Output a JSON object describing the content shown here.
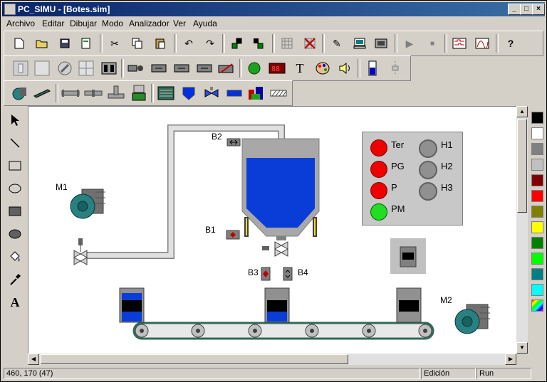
{
  "window": {
    "title": "PC_SIMU - [Botes.sim]"
  },
  "menu": [
    "Archivo",
    "Editar",
    "Dibujar",
    "Modo",
    "Analizador",
    "Ver",
    "Ayuda"
  ],
  "diagram": {
    "labels": {
      "m1": "M1",
      "m2": "M2",
      "b1": "B1",
      "b2": "B2",
      "b3": "B3",
      "b4": "B4"
    },
    "panel": {
      "lamps": [
        {
          "label": "Ter",
          "color": "#ee0000"
        },
        {
          "label": "PG",
          "color": "#ee0000"
        },
        {
          "label": "P",
          "color": "#ee0000"
        },
        {
          "label": "PM",
          "color": "#22dd22"
        }
      ],
      "indicators": [
        "H1",
        "H2",
        "H3"
      ]
    },
    "colors": {
      "liquid": "#0a3cd8",
      "pipe": "#d4d0c8",
      "conveyor": "#2f6a55"
    }
  },
  "palette": [
    "#000000",
    "#ffffff",
    "#808080",
    "#c0c0c0",
    "#800000",
    "#ff0000",
    "#808000",
    "#ffff00",
    "#008000",
    "#00ff00",
    "#008080",
    "#00ffff",
    "rainbow"
  ],
  "status": {
    "coords": "460, 170 (47)",
    "mode1": "Edición",
    "mode2": "Run"
  }
}
